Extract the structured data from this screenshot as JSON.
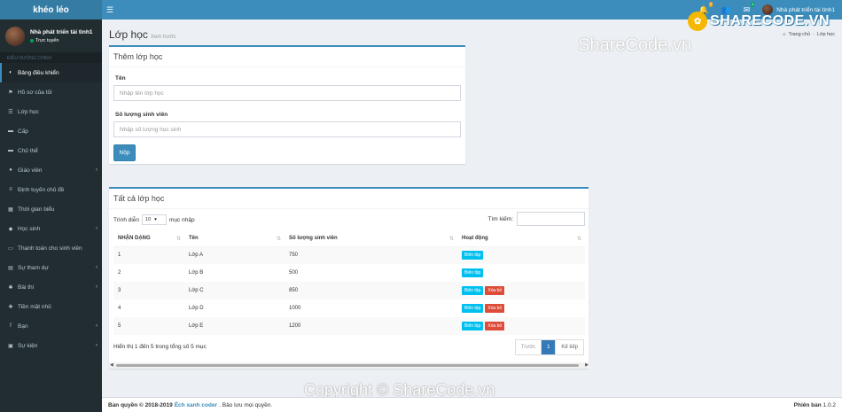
{
  "header": {
    "logo": "khéo léo",
    "toggle_icon": "bars-icon",
    "notif_badge": "9",
    "user_badge": "",
    "mail_badge": "4",
    "user_name": "Nhà phát triển tài tình1"
  },
  "sidebar": {
    "user_name": "Nhà phát triển tài tình1",
    "status": "Trực tuyến",
    "section": "ĐIỀU HƯỚNG CHÍNH",
    "items": [
      {
        "label": "Bảng điều khiển",
        "icon": "dashboard-icon",
        "chev": ""
      },
      {
        "label": "Hồ sơ của tôi",
        "icon": "flag-icon",
        "chev": ""
      },
      {
        "label": "Lớp học",
        "icon": "list-icon",
        "chev": ""
      },
      {
        "label": "Cấp",
        "icon": "folder-icon",
        "chev": ""
      },
      {
        "label": "Chủ thể",
        "icon": "folder-icon",
        "chev": ""
      },
      {
        "label": "Giáo viên",
        "icon": "user-icon",
        "chev": "‹"
      },
      {
        "label": "Định tuyến chủ đề",
        "icon": "route-icon",
        "chev": ""
      },
      {
        "label": "Thời gian biểu",
        "icon": "calendar-icon",
        "chev": ""
      },
      {
        "label": "Học sinh",
        "icon": "students-icon",
        "chev": "‹"
      },
      {
        "label": "Thanh toán cho sinh viên",
        "icon": "payment-icon",
        "chev": ""
      },
      {
        "label": "Sự tham dự",
        "icon": "attendance-icon",
        "chev": "‹"
      },
      {
        "label": "Bài thi",
        "icon": "exam-icon",
        "chev": "‹"
      },
      {
        "label": "Tiền mặt nhỏ",
        "icon": "cash-icon",
        "chev": ""
      },
      {
        "label": "Bạn",
        "icon": "facebook-icon",
        "chev": "‹"
      },
      {
        "label": "Sự kiện",
        "icon": "event-icon",
        "chev": "‹"
      }
    ]
  },
  "content": {
    "title": "Lớp học",
    "subtitle": "Xem trước",
    "breadcrumb_home": "Trang chủ",
    "breadcrumb_current": "Lớp học"
  },
  "add_form": {
    "title": "Thêm lớp học",
    "name_label": "Tên",
    "name_placeholder": "Nhập tên lớp học",
    "count_label": "Số lượng sinh viên",
    "count_placeholder": "Nhập số lượng học sinh",
    "submit": "Nộp"
  },
  "list": {
    "title": "Tất cả lớp học",
    "show_label": "Trình diễn",
    "show_value": "10",
    "entries_label": "mục nhập",
    "search_label": "Tìm kiếm:",
    "columns": [
      "NHẬN DẠNG",
      "Tên",
      "Số lượng sinh viên",
      "Hoạt động"
    ],
    "edit_label": "Biên tập",
    "delete_label": "Xóa bỏ",
    "rows": [
      {
        "id": "1",
        "name": "Lớp A",
        "count": "750"
      },
      {
        "id": "2",
        "name": "Lớp B",
        "count": "500"
      },
      {
        "id": "3",
        "name": "Lớp C",
        "count": "850"
      },
      {
        "id": "4",
        "name": "Lớp D",
        "count": "1000"
      },
      {
        "id": "5",
        "name": "Lớp E",
        "count": "1200"
      }
    ],
    "info": "Hiển thị 1 đến 5 trong tổng số 5 mục",
    "prev": "Trước",
    "page": "1",
    "next": "Kế tiếp"
  },
  "watermarks": {
    "top": "ShareCode.vn",
    "brand": "SHARECODE.VN",
    "bottom": "Copyright © ShareCode.vn"
  },
  "footer": {
    "prefix": "Bản quyền © 2018-2019",
    "link": "Ếch xanh coder",
    "suffix": ". Bảo lưu mọi quyền.",
    "version_label": "Phiên bản",
    "version": "1.0.2"
  }
}
